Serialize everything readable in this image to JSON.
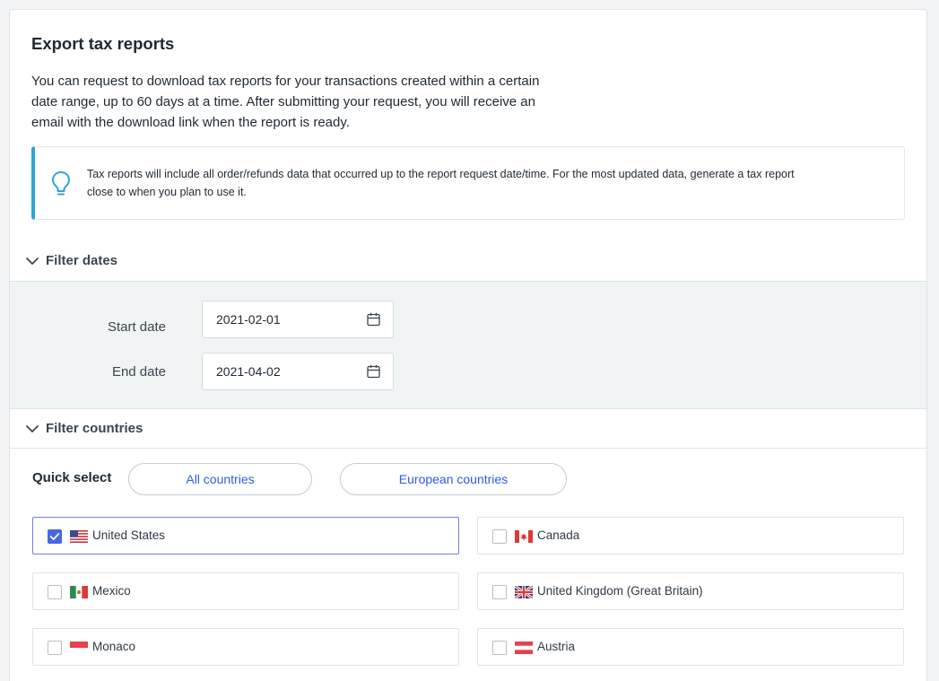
{
  "page": {
    "title": "Export tax reports",
    "description": "You can request to download tax reports for your transactions created within a certain date range, up to 60 days at a time. After submitting your request, you will receive an email with the download link when the report is ready."
  },
  "callout": {
    "icon": "lightbulb-icon",
    "text": "Tax reports will include all order/refunds data that occurred up to the report request date/time. For the most updated data, generate a tax report close to when you plan to use it."
  },
  "filter_dates": {
    "heading": "Filter dates",
    "start_label": "Start date",
    "start_value": "2021-02-01",
    "end_label": "End date",
    "end_value": "2021-04-02"
  },
  "filter_countries": {
    "heading": "Filter countries",
    "quick_select_label": "Quick select",
    "all_countries_label": "All countries",
    "european_countries_label": "European countries",
    "countries": [
      {
        "name": "United States",
        "checked": true,
        "flag": "us-flag-icon"
      },
      {
        "name": "Canada",
        "checked": false,
        "flag": "canada-flag-icon"
      },
      {
        "name": "Mexico",
        "checked": false,
        "flag": "mexico-flag-icon"
      },
      {
        "name": "United Kingdom (Great Britain)",
        "checked": false,
        "flag": "uk-flag-icon"
      },
      {
        "name": "Monaco",
        "checked": false,
        "flag": "monaco-flag-icon"
      },
      {
        "name": "Austria",
        "checked": false,
        "flag": "austria-flag-icon"
      }
    ]
  },
  "colors": {
    "accent_blue": "#2c5ce6",
    "checkbox_blue": "#4a67e0",
    "callout_border": "#2fa4d6",
    "dates_panel_bg": "#f0f4f4"
  }
}
